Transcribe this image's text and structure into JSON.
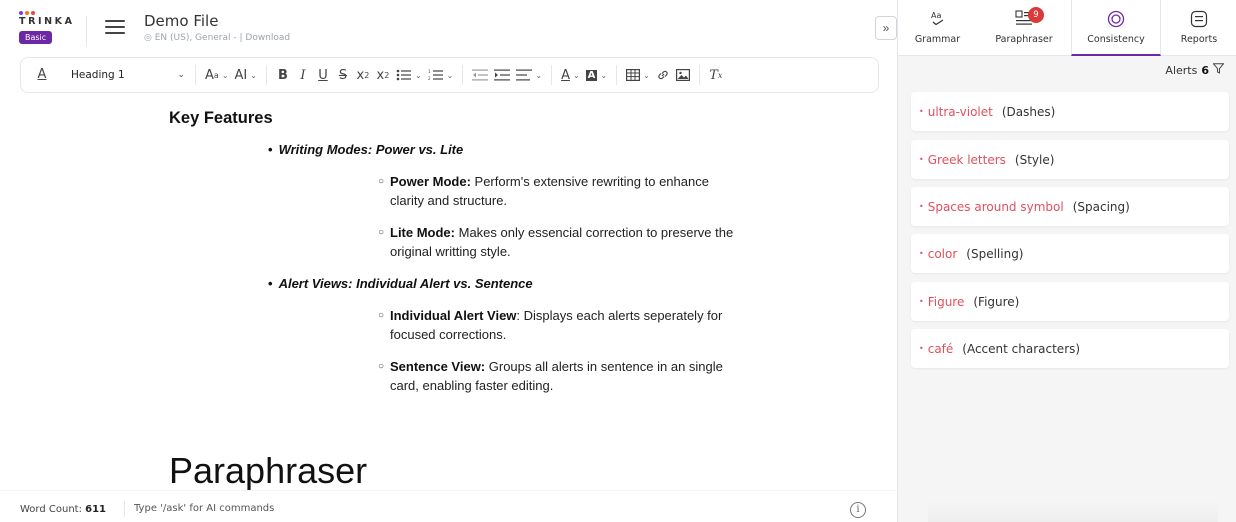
{
  "app": {
    "logo_text": "TRINKA",
    "plan_badge": "Basic",
    "logo_dot_colors": [
      "#7c3aed",
      "#f97316",
      "#ef4444"
    ]
  },
  "document": {
    "title": "Demo File",
    "meta": "EN (US), General - | Download"
  },
  "toolbar": {
    "style_select": "Heading 1",
    "icons": [
      "text-color-icon",
      "font-size-icon",
      "text-case-icon",
      "bold-icon",
      "italic-icon",
      "underline-icon",
      "strikethrough-icon",
      "subscript-icon",
      "superscript-icon",
      "bullet-list-icon",
      "numbered-list-icon",
      "outdent-icon",
      "indent-icon",
      "align-icon",
      "font-color-icon",
      "highlight-icon",
      "table-icon",
      "link-icon",
      "image-icon",
      "clear-format-icon"
    ]
  },
  "content": {
    "heading": "Key Features",
    "sections": [
      {
        "title": "Writing Modes: Power vs. Lite",
        "items": [
          {
            "bold": "Power Mode:",
            "text": " Perform's extensive rewriting to enhance clarity and structure."
          },
          {
            "bold": "Lite Mode:",
            "text": " Makes only essencial correction to preserve the original writting style."
          }
        ]
      },
      {
        "title": "Alert Views: Individual Alert vs. Sentence",
        "items": [
          {
            "bold": "Individual Alert View",
            "text": ": Displays each alerts seperately for focused corrections."
          },
          {
            "bold": "Sentence View:",
            "text": " Groups all alerts in sentence in an single card, enabling faster editing."
          }
        ]
      }
    ],
    "next_heading": "Paraphraser"
  },
  "status": {
    "word_count_label": "Word Count:",
    "word_count_value": "611",
    "ask_hint": "Type '/ask' for AI commands"
  },
  "panel": {
    "tabs": [
      {
        "label": "Grammar",
        "icon": "grammar-icon"
      },
      {
        "label": "Paraphraser",
        "icon": "paraphraser-icon",
        "badge": "9"
      },
      {
        "label": "Consistency",
        "icon": "consistency-icon",
        "active": true
      },
      {
        "label": "Reports",
        "icon": "reports-icon"
      }
    ],
    "alerts_label": "Alerts",
    "alerts_count": "6",
    "alerts": [
      {
        "term": "ultra-violet",
        "category": "(Dashes)"
      },
      {
        "term": "Greek letters",
        "category": "(Style)"
      },
      {
        "term": "Spaces around symbol",
        "category": "(Spacing)"
      },
      {
        "term": "color",
        "category": "(Spelling)"
      },
      {
        "term": "Figure",
        "category": "(Figure)"
      },
      {
        "term": "café",
        "category": "(Accent characters)"
      }
    ],
    "colors": {
      "accent": "#6d28a6",
      "alert_red": "#e0505a",
      "badge_red": "#d93a3a"
    }
  }
}
